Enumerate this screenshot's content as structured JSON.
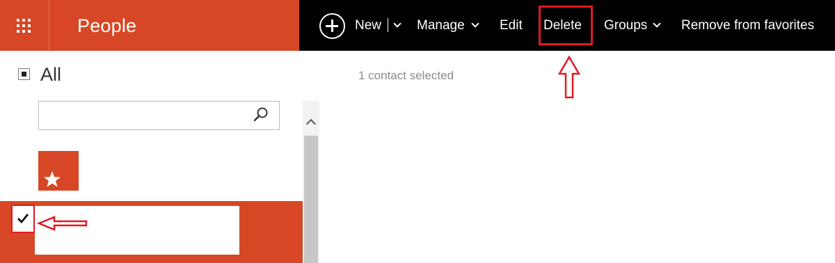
{
  "app": {
    "title": "People"
  },
  "command_bar": {
    "new_label": "New",
    "manage_label": "Manage",
    "edit_label": "Edit",
    "delete_label": "Delete",
    "groups_label": "Groups",
    "remove_favorites_label": "Remove from favorites"
  },
  "sidebar": {
    "filter_label": "All",
    "search": {
      "placeholder": "",
      "value": ""
    }
  },
  "main": {
    "selection_status": "1 contact selected"
  },
  "icons": {
    "app_launcher": "waffle-icon",
    "new": "plus-circle-icon",
    "search": "search-icon",
    "favorites": "star-icon",
    "checkbox": "checkmark-icon"
  },
  "colors": {
    "brand": "#d74726",
    "command_bar": "#000000",
    "annotation": "#e01822"
  }
}
